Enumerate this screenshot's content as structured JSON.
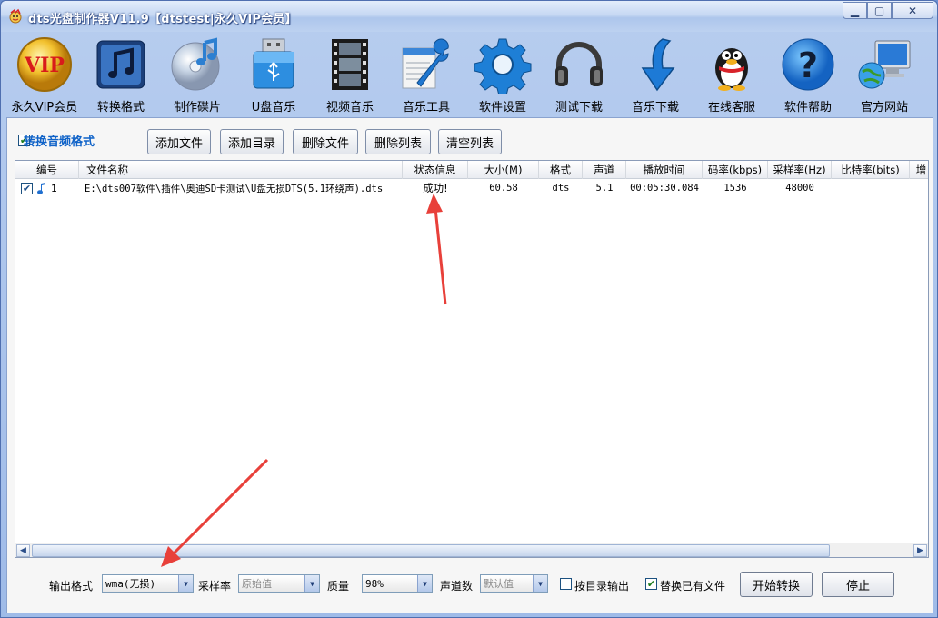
{
  "window": {
    "title": "dts光盘制作器V11.9【dtstest|永久VIP会员】",
    "minimize": "▭",
    "restore": "◻",
    "close": "✕"
  },
  "toolbar": [
    {
      "label": "永久VIP会员",
      "icon": "vip-badge-icon"
    },
    {
      "label": "转换格式",
      "icon": "music-note-icon"
    },
    {
      "label": "制作碟片",
      "icon": "disc-icon"
    },
    {
      "label": "U盘音乐",
      "icon": "usb-drive-icon"
    },
    {
      "label": "视频音乐",
      "icon": "film-strip-icon"
    },
    {
      "label": "音乐工具",
      "icon": "wrench-icon"
    },
    {
      "label": "软件设置",
      "icon": "gear-icon"
    },
    {
      "label": "测试下载",
      "icon": "headphones-icon"
    },
    {
      "label": "音乐下载",
      "icon": "download-arrow-icon"
    },
    {
      "label": "在线客服",
      "icon": "penguin-icon"
    },
    {
      "label": "软件帮助",
      "icon": "help-icon"
    },
    {
      "label": "官方网站",
      "icon": "globe-computer-icon"
    }
  ],
  "actions": {
    "mode_label": "转换音频格式",
    "mode_checked": true,
    "add_file": "添加文件",
    "add_dir": "添加目录",
    "delete_file": "删除文件",
    "delete_list": "删除列表",
    "clear_list": "清空列表"
  },
  "table": {
    "columns": [
      "编号",
      "文件名称",
      "状态信息",
      "大小(M)",
      "格式",
      "声道",
      "播放时间",
      "码率(kbps)",
      "采样率(Hz)",
      "比特率(bits)",
      "增"
    ],
    "rows": [
      {
        "num": "1",
        "name": "E:\\dts007软件\\插件\\奥迪SD卡测试\\U盘无损DTS(5.1环绕声).dts",
        "status": "成功!",
        "size": "60.58",
        "format": "dts",
        "channels": "5.1",
        "duration": "00:05:30.084",
        "bitrate": "1536",
        "samplerate": "48000",
        "bits": ""
      }
    ]
  },
  "bottom": {
    "output_format_label": "输出格式",
    "output_format_value": "wma(无损)",
    "samplerate_label": "采样率",
    "samplerate_value": "原始值",
    "quality_label": "质量",
    "quality_value": "98%",
    "channels_label": "声道数",
    "channels_value": "默认值",
    "dir_output_label": "按目录输出",
    "dir_output_checked": false,
    "replace_label": "替换已有文件",
    "replace_checked": true,
    "start_button": "开始转换",
    "stop_button": "停止"
  },
  "colors": {
    "accent": "#1063c8",
    "annotation_arrow": "#e8403a"
  }
}
